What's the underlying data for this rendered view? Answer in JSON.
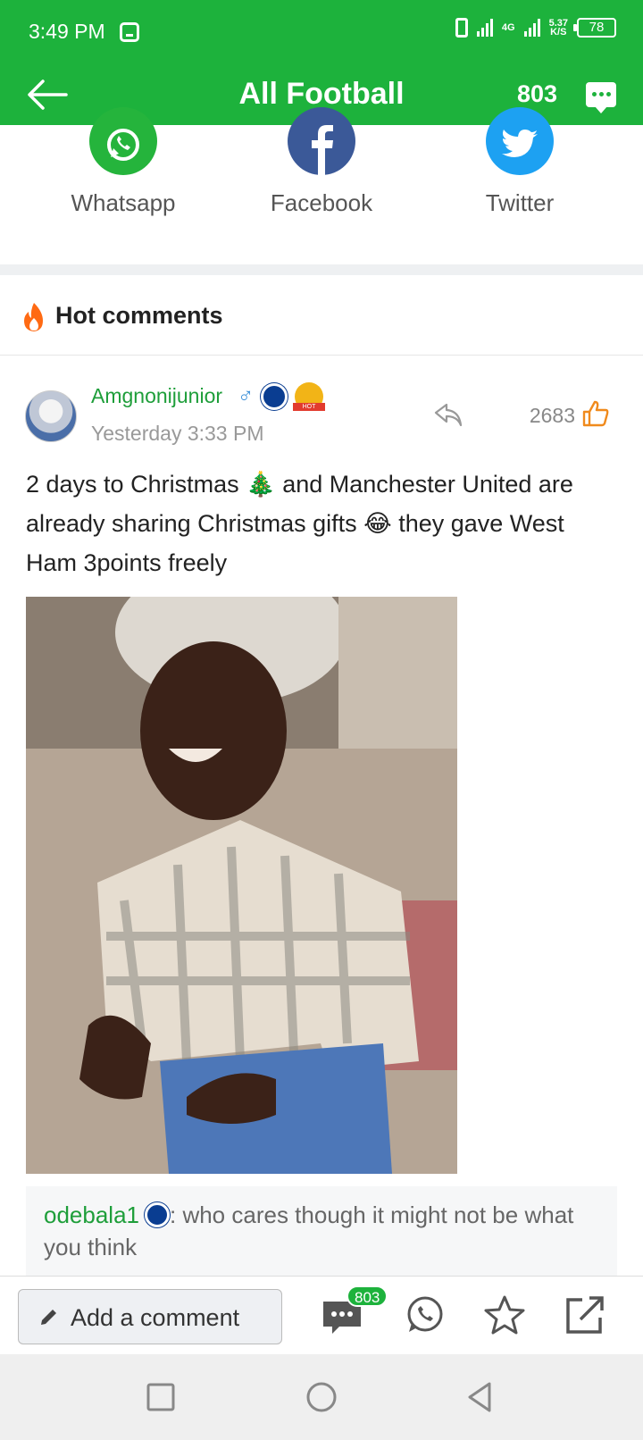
{
  "status_bar": {
    "time": "3:49 PM",
    "network": "4G",
    "speed": "5.37",
    "speed_unit": "K/S",
    "battery": "78"
  },
  "app_bar": {
    "title": "All Football",
    "comment_count": "803"
  },
  "share": {
    "items": [
      {
        "label": "Whatsapp",
        "color": "#25b43c",
        "icon": "whatsapp-icon"
      },
      {
        "label": "Facebook",
        "color": "#3b5998",
        "icon": "facebook-icon"
      },
      {
        "label": "Twitter",
        "color": "#1da1f2",
        "icon": "twitter-icon"
      }
    ]
  },
  "hot_comments": {
    "title": "Hot comments"
  },
  "comment": {
    "username": "Amgnonijunior",
    "gender_symbol": "♂",
    "medal_label": "HOT",
    "timestamp": "Yesterday 3:33 PM",
    "likes": "2683",
    "text": "2 days to Christmas 🎄 and Manchester United are already sharing Christmas gifts 😂 they gave West Ham 3points freely",
    "reply": {
      "username": "odebala1",
      "text": ": who cares though it might not be what you think"
    }
  },
  "action_bar": {
    "add_comment_label": "Add a comment",
    "comment_count": "803"
  },
  "colors": {
    "brand_green": "#1db23c",
    "username_green": "#1e9e3a"
  }
}
